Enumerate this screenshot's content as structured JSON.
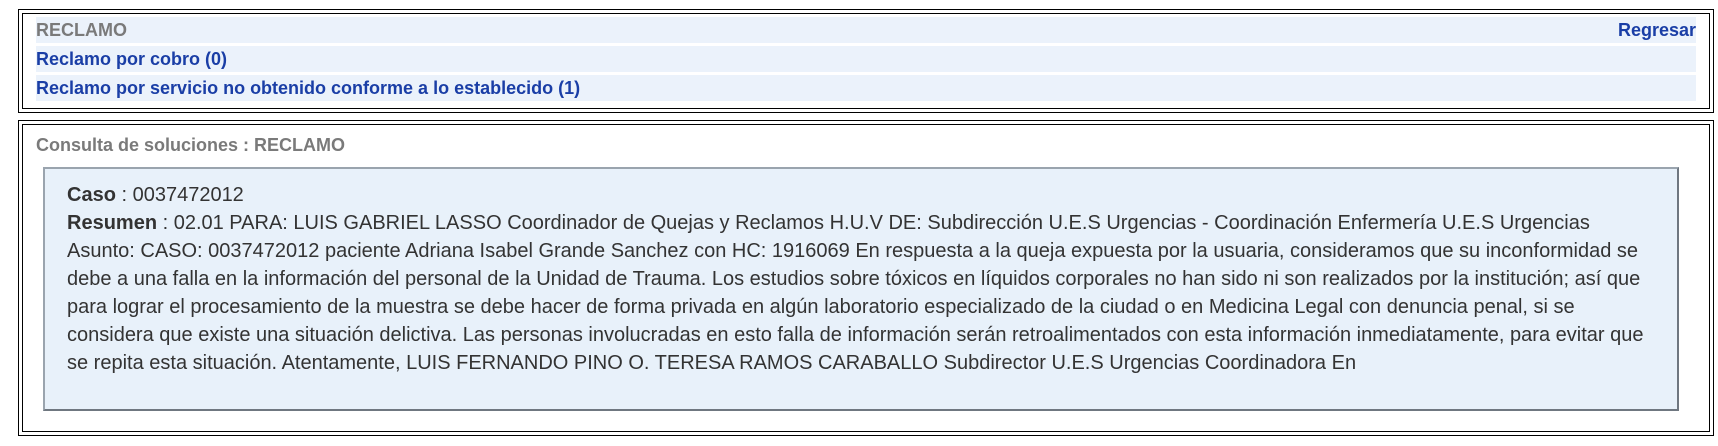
{
  "reclamo": {
    "title": "RECLAMO",
    "back_label": "Regresar",
    "items": [
      {
        "label": "Reclamo por cobro (0)"
      },
      {
        "label": "Reclamo por servicio no obtenido conforme a lo establecido (1)"
      }
    ]
  },
  "consulta": {
    "title": "Consulta de soluciones : RECLAMO",
    "case_label": "Caso",
    "separator": " : ",
    "case_number": "0037472012",
    "summary_label": "Resumen",
    "summary_text": "02.01 PARA: LUIS GABRIEL LASSO Coordinador de Quejas y Reclamos H.U.V DE: Subdirección U.E.S Urgencias - Coordinación Enfermería U.E.S Urgencias Asunto: CASO: 0037472012 paciente Adriana Isabel Grande Sanchez con HC: 1916069 En respuesta a la queja expuesta por la usuaria, consideramos que su inconformidad se debe a una falla en la información del personal de la Unidad de Trauma. Los estudios sobre tóxicos en líquidos corporales no han sido ni son realizados por la institución; así que para lograr el procesamiento de la muestra se debe hacer de forma privada en algún laboratorio especializado de la ciudad o en Medicina Legal con denuncia penal, si se considera que existe una situación delictiva. Las personas involucradas en esto falla de información serán retroalimentados con esta información inmediatamente, para evitar que se repita esta situación. Atentamente, LUIS FERNANDO PINO O. TERESA RAMOS CARABALLO Subdirector U.E.S Urgencias Coordinadora En"
  }
}
